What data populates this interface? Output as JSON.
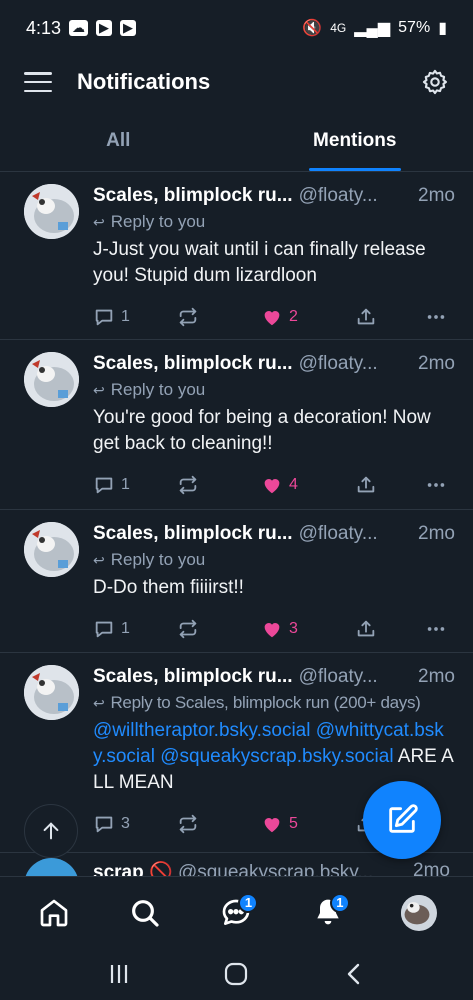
{
  "status_bar": {
    "time": "4:13",
    "network": "4G",
    "battery": "57%"
  },
  "header": {
    "title": "Notifications"
  },
  "tabs": [
    {
      "label": "All",
      "active": false
    },
    {
      "label": "Mentions",
      "active": true
    }
  ],
  "notifications": [
    {
      "author": "Scales, blimplock ru...",
      "handle": "@floaty...",
      "time": "2mo",
      "reply_to": "Reply to you",
      "text": "J-Just you wait until i can finally release you! Stupid dum lizardloon",
      "replies": "1",
      "likes": "2"
    },
    {
      "author": "Scales, blimplock ru...",
      "handle": "@floaty...",
      "time": "2mo",
      "reply_to": "Reply to you",
      "text": "You're good for being a decoration! Now get back to cleaning!!",
      "replies": "1",
      "likes": "4"
    },
    {
      "author": "Scales, blimplock ru...",
      "handle": "@floaty...",
      "time": "2mo",
      "reply_to": "Reply to you",
      "text": "D-Do them fiiiirst!!",
      "replies": "1",
      "likes": "3"
    },
    {
      "author": "Scales, blimplock ru...",
      "handle": "@floaty...",
      "time": "2mo",
      "reply_to": "Reply to Scales, blimplock run (200+ days)",
      "mention1": "@willtheraptor.bsky.social",
      "mention2": "@whittycat.bsky.social",
      "mention3": "@squeakyscrap.bsky.social",
      "text_tail": " ARE ALL MEAN",
      "replies": "3",
      "likes": "5"
    }
  ],
  "peek_item": {
    "author": "scrap",
    "handle": "@squeakyscrap.bsky...",
    "time": "2mo"
  },
  "bottom_nav": {
    "chat_badge": "1",
    "notifications_badge": "1"
  },
  "colors": {
    "background": "#161e27",
    "accent": "#1083fe",
    "like": "#ec4899",
    "muted": "#93a2b5",
    "mention": "#208bfe"
  }
}
